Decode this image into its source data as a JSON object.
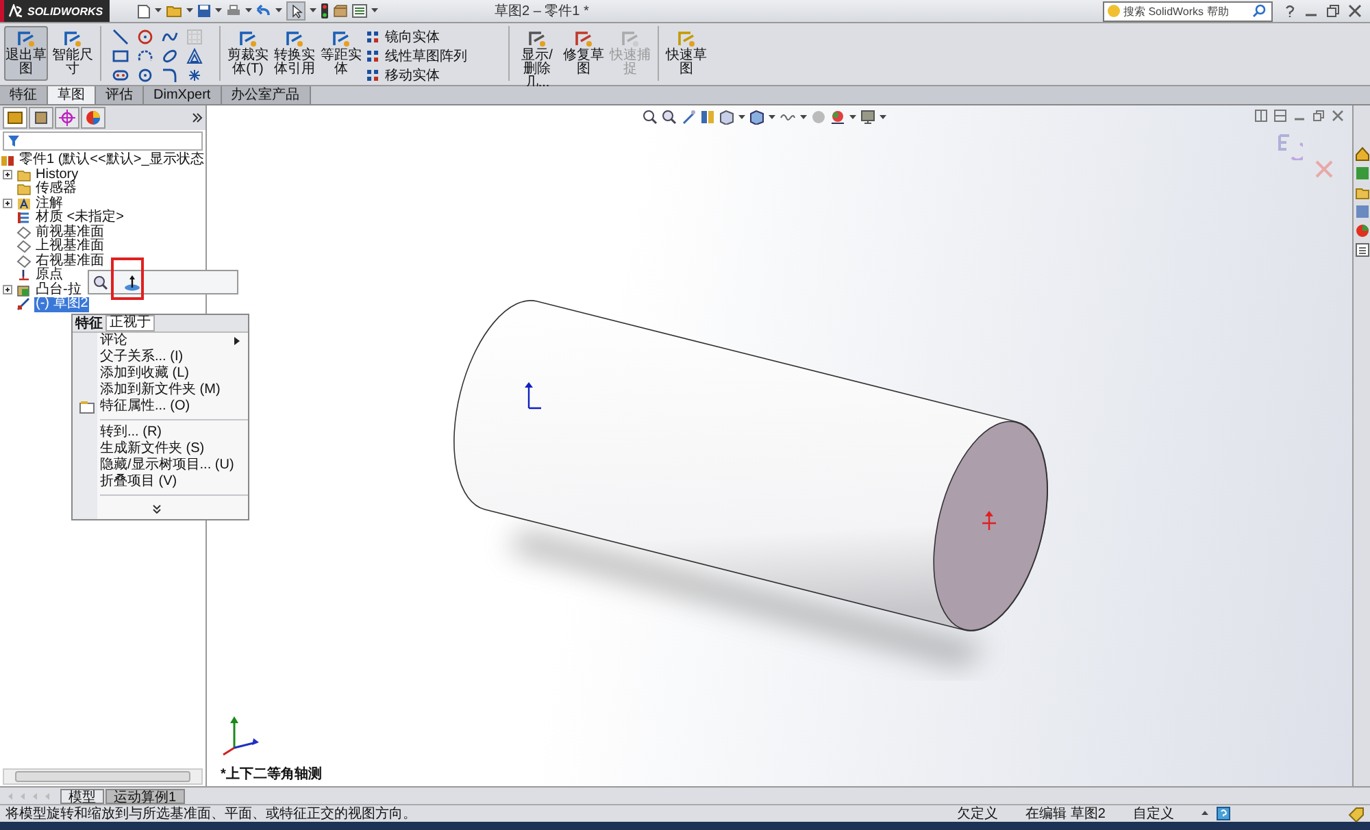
{
  "title_bar": {
    "logo": "SOLIDWORKS",
    "title": "草图2 – 零件1 *",
    "search": {
      "placeholder": "搜索 SolidWorks 帮助"
    }
  },
  "ribbon": [
    {
      "kind": "large",
      "label": "退出草图",
      "selected": true,
      "disabled": false
    },
    {
      "kind": "large",
      "label": "智能尺寸",
      "selected": false,
      "disabled": false
    },
    {
      "kind": "tools"
    },
    {
      "kind": "large",
      "label": "剪裁实体(T)",
      "selected": false,
      "disabled": false
    },
    {
      "kind": "large",
      "label": "转换实体引用",
      "selected": false,
      "disabled": false
    },
    {
      "kind": "large",
      "label": "等距实体",
      "selected": false,
      "disabled": false
    },
    {
      "kind": "list",
      "items": [
        "镜向实体",
        "线性草图阵列",
        "移动实体"
      ]
    },
    {
      "kind": "large",
      "label": "显示/删除几...",
      "selected": false,
      "disabled": false
    },
    {
      "kind": "large",
      "label": "修复草图",
      "selected": false,
      "disabled": false
    },
    {
      "kind": "large",
      "label": "快速捕捉",
      "selected": false,
      "disabled": true
    },
    {
      "kind": "large",
      "label": "快速草图",
      "selected": false,
      "disabled": false
    }
  ],
  "command_tabs": [
    {
      "label": "特征",
      "selected": false
    },
    {
      "label": "草图",
      "selected": true
    },
    {
      "label": "评估",
      "selected": false
    },
    {
      "label": "DimXpert",
      "selected": false
    },
    {
      "label": "办公室产品",
      "selected": false
    }
  ],
  "feature_tree": {
    "root": {
      "label": "零件1 (默认<<默认>_显示状态",
      "selected": false,
      "children": [
        {
          "label": "History",
          "collapsed": true,
          "selected": false
        },
        {
          "label": "传感器",
          "collapsed": false,
          "selected": false
        },
        {
          "label": "注解",
          "collapsed": true,
          "selected": false
        },
        {
          "label": "材质 <未指定>",
          "collapsed": false,
          "selected": false
        },
        {
          "label": "前视基准面",
          "collapsed": false,
          "selected": false
        },
        {
          "label": "上视基准面",
          "collapsed": false,
          "selected": false
        },
        {
          "label": "右视基准面",
          "collapsed": false,
          "selected": false
        },
        {
          "label": "原点",
          "collapsed": false,
          "selected": false
        },
        {
          "label": "凸台-拉",
          "collapsed": true,
          "selected": false
        },
        {
          "label": "(-) 草图2",
          "collapsed": false,
          "selected": true
        }
      ]
    }
  },
  "context_menu": {
    "title": "特征",
    "tooltip": "正视于",
    "items": [
      {
        "kind": "submenu",
        "label": "评论"
      },
      {
        "kind": "item",
        "label": "父子关系... (I)"
      },
      {
        "kind": "item",
        "label": "添加到收藏 (L)"
      },
      {
        "kind": "item",
        "label": "添加到新文件夹 (M)"
      },
      {
        "kind": "icon-item",
        "label": "特征属性... (O)"
      },
      {
        "kind": "separator"
      },
      {
        "kind": "item",
        "label": "转到... (R)"
      },
      {
        "kind": "item",
        "label": "生成新文件夹 (S)"
      },
      {
        "kind": "item",
        "label": "隐藏/显示树项目... (U)"
      },
      {
        "kind": "item",
        "label": "折叠项目 (V)"
      },
      {
        "kind": "separator"
      },
      {
        "kind": "more"
      }
    ]
  },
  "viewport": {
    "view_label": "*上下二等角轴测"
  },
  "bottom_tabs": [
    {
      "label": "模型",
      "selected": true
    },
    {
      "label": "运动算例1",
      "selected": false
    }
  ],
  "status_bar": {
    "message": "将模型旋转和缩放到与所选基准面、平面、或特征正交的视图方向。",
    "fields": [
      "欠定义",
      "在编辑 草图2",
      "自定义"
    ]
  }
}
